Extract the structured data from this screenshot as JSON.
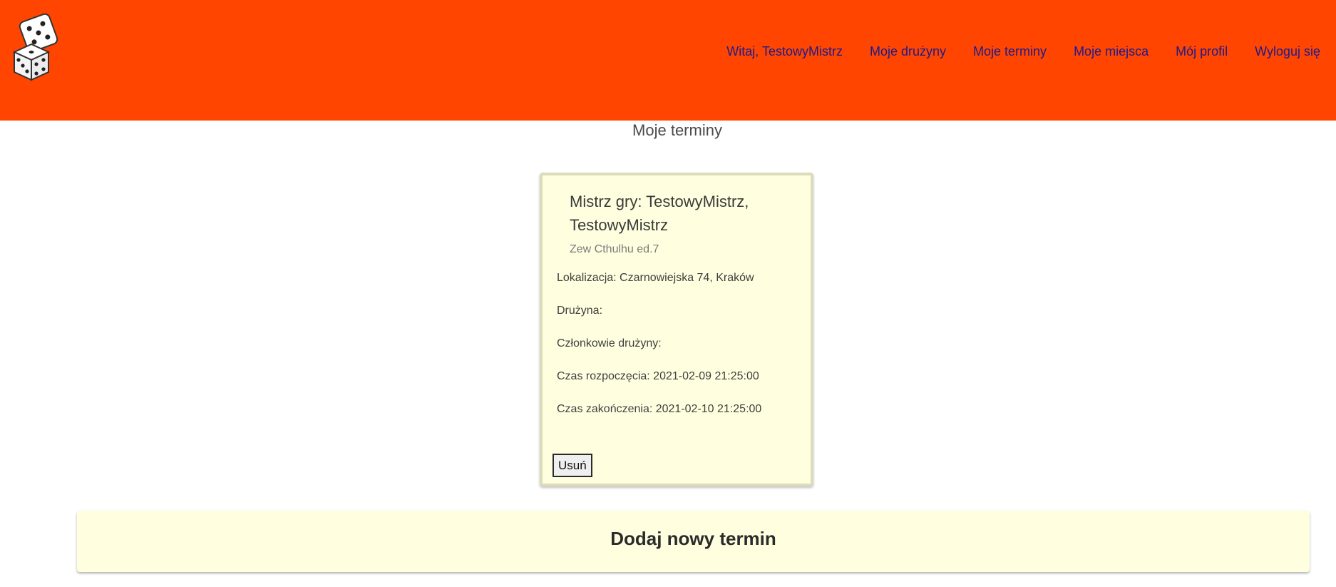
{
  "header": {
    "logo_icon": "dice-icon",
    "brand_color": "#ff4500",
    "nav_items": [
      {
        "label": "Witaj, TestowyMistrz"
      },
      {
        "label": "Moje drużyny"
      },
      {
        "label": "Moje terminy"
      },
      {
        "label": "Moje miejsca"
      },
      {
        "label": "Mój profil"
      },
      {
        "label": "Wyloguj się"
      }
    ]
  },
  "main": {
    "page_title": "Moje terminy",
    "session_card": {
      "title": "Mistrz gry: TestowyMistrz, TestowyMistrz",
      "subtitle": "Zew Cthulhu ed.7",
      "location": "Lokalizacja: Czarnowiejska 74, Kraków",
      "team": "Drużyna:",
      "team_members": "Członkowie drużyny:",
      "start_time": "Czas rozpoczęcia: 2021-02-09 21:25:00",
      "end_time": "Czas zakończenia: 2021-02-10 21:25:00",
      "delete_label": "Usuń",
      "background_color": "#ffffe0"
    },
    "add_section": {
      "title": "Dodaj nowy termin"
    }
  }
}
